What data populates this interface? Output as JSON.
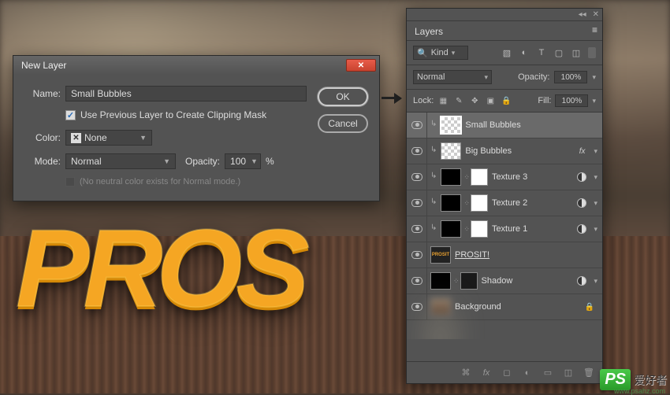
{
  "dialog": {
    "title": "New Layer",
    "name_label": "Name:",
    "name_value": "Small Bubbles",
    "clip_label": "Use Previous Layer to Create Clipping Mask",
    "color_label": "Color:",
    "color_value": "None",
    "mode_label": "Mode:",
    "mode_value": "Normal",
    "opacity_label": "Opacity:",
    "opacity_value": "100",
    "opacity_suffix": "%",
    "neutral_note": "(No neutral color exists for Normal mode.)",
    "ok": "OK",
    "cancel": "Cancel"
  },
  "panel": {
    "tab": "Layers",
    "filter_kind": "Kind",
    "blend_mode": "Normal",
    "opacity_label": "Opacity:",
    "opacity_value": "100%",
    "lock_label": "Lock:",
    "fill_label": "Fill:",
    "fill_value": "100%",
    "layers": [
      {
        "name": "Small Bubbles",
        "clip": true,
        "thumb": "checker",
        "selected": true
      },
      {
        "name": "Big Bubbles",
        "clip": true,
        "thumb": "checker",
        "fx": true
      },
      {
        "name": "Texture 3",
        "clip": true,
        "thumb": "black",
        "mask": true,
        "adv": true
      },
      {
        "name": "Texture 2",
        "clip": true,
        "thumb": "black",
        "mask": true,
        "adv": true
      },
      {
        "name": "Texture 1",
        "clip": true,
        "thumb": "black",
        "mask": true,
        "adv": true
      },
      {
        "name": "PROSIT!",
        "thumb": "text",
        "underline": true
      },
      {
        "name": "Shadow",
        "thumb": "black",
        "mask": "dark",
        "adv": true
      },
      {
        "name": "Background",
        "thumb": "bg",
        "locked": true
      }
    ]
  },
  "bg_text": "PROS",
  "watermark": {
    "ps": "PS",
    "text": "爱好者",
    "url": "www.psahz.com"
  }
}
